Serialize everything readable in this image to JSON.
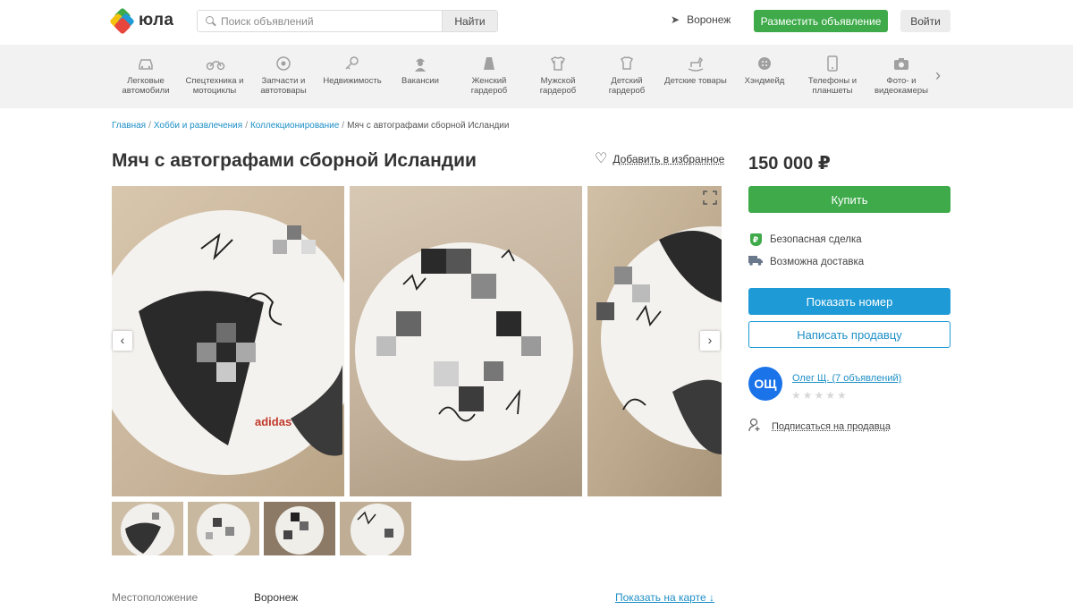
{
  "header": {
    "logo_text": "юла",
    "search_placeholder": "Поиск объявлений",
    "search_button": "Найти",
    "city": "Воронеж",
    "post_button": "Разместить объявление",
    "login_button": "Войти"
  },
  "categories": [
    {
      "label": "Легковые автомобили",
      "icon": "car-icon"
    },
    {
      "label": "Спецтехника и мотоциклы",
      "icon": "motorcycle-icon"
    },
    {
      "label": "Запчасти и автотовары",
      "icon": "wheel-icon"
    },
    {
      "label": "Недвижимость",
      "icon": "key-icon"
    },
    {
      "label": "Вакансии",
      "icon": "worker-icon"
    },
    {
      "label": "Женский гардероб",
      "icon": "skirt-icon"
    },
    {
      "label": "Мужской гардероб",
      "icon": "tshirt-icon"
    },
    {
      "label": "Детский гардероб",
      "icon": "kids-shirt-icon"
    },
    {
      "label": "Детские товары",
      "icon": "rocking-horse-icon"
    },
    {
      "label": "Хэндмейд",
      "icon": "button-icon"
    },
    {
      "label": "Телефоны и планшеты",
      "icon": "phone-icon"
    },
    {
      "label": "Фото- и видеокамеры",
      "icon": "camera-icon"
    }
  ],
  "breadcrumb": {
    "items": [
      "Главная",
      "Хобби и развлечения",
      "Коллекционирование"
    ],
    "current": "Мяч с автографами сборной Исландии",
    "separator": "/"
  },
  "listing": {
    "title": "Мяч с автографами сборной Исландии",
    "favorite_label": "Добавить в избранное",
    "price": "150 000 ₽",
    "buy_button": "Купить",
    "features": [
      {
        "label": "Безопасная сделка",
        "icon": "shield-icon"
      },
      {
        "label": "Возможна доставка",
        "icon": "truck-icon"
      }
    ],
    "show_phone_button": "Показать номер",
    "write_seller_button": "Написать продавцу"
  },
  "seller": {
    "initials": "ОЩ",
    "name": "Олег Щ. (7 объявлений)",
    "rating": 0,
    "rating_max": 5,
    "subscribe_label": "Подписаться на продавца"
  },
  "location": {
    "label": "Местоположение",
    "value": "Воронеж",
    "map_link": "Показать на карте ↓"
  },
  "colors": {
    "green": "#3eaa4a",
    "blue": "#1e9ad6",
    "link": "#1e8fc6",
    "avatar": "#1a73e8"
  }
}
